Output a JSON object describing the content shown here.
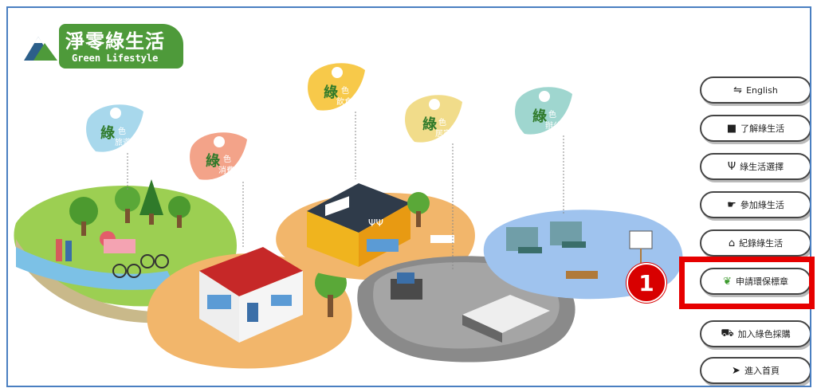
{
  "logo": {
    "title": "淨零綠生活",
    "subtitle": "Green Lifestyle"
  },
  "scene": {
    "leaves": [
      {
        "main": "綠",
        "sub1": "色",
        "sub2": "旅遊"
      },
      {
        "main": "綠",
        "sub1": "色",
        "sub2": "消費"
      },
      {
        "main": "綠",
        "sub1": "色",
        "sub2": "飲食"
      },
      {
        "main": "綠",
        "sub1": "色",
        "sub2": "居家"
      },
      {
        "main": "綠",
        "sub1": "色",
        "sub2": "辦公"
      }
    ],
    "shop_sign": "ΨΨ"
  },
  "menu": {
    "items": [
      {
        "label": "English",
        "icon": "language-icon"
      },
      {
        "label": "了解綠生活",
        "icon": "book-icon"
      },
      {
        "label": "綠生活選擇",
        "icon": "utensils-icon"
      },
      {
        "label": "參加綠生活",
        "icon": "thumbs-up-icon"
      },
      {
        "label": "紀錄綠生活",
        "icon": "home-icon"
      },
      {
        "label": "申請環保標章",
        "icon": "leaf-icon"
      },
      {
        "label": "加入綠色採購",
        "icon": "cart-icon"
      },
      {
        "label": "進入首頁",
        "icon": "send-icon"
      }
    ]
  },
  "annotation": {
    "step_number": "1",
    "highlight_color": "#e60000"
  },
  "colors": {
    "brand_green": "#4e9a3a",
    "frame_blue": "#4a7fc1"
  }
}
